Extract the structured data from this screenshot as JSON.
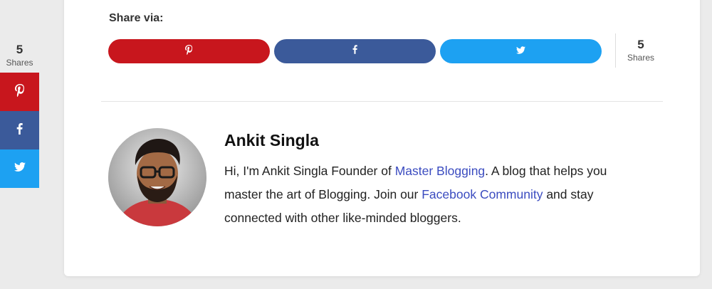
{
  "sidebar": {
    "count": "5",
    "count_label": "Shares",
    "buttons": [
      {
        "network": "pinterest",
        "icon": "pinterest-icon",
        "color": "#c8161d"
      },
      {
        "network": "facebook",
        "icon": "facebook-icon",
        "color": "#3b5a9a"
      },
      {
        "network": "twitter",
        "icon": "twitter-icon",
        "color": "#1da1f2"
      }
    ]
  },
  "share": {
    "label": "Share via:",
    "total": "5",
    "total_label": "Shares",
    "buttons": [
      {
        "network": "pinterest",
        "icon": "pinterest-icon",
        "color": "#c8161d"
      },
      {
        "network": "facebook",
        "icon": "facebook-icon",
        "color": "#3b5a9a"
      },
      {
        "network": "twitter",
        "icon": "twitter-icon",
        "color": "#1da1f2"
      }
    ]
  },
  "author": {
    "name": "Ankit Singla",
    "bio_part1": "Hi, I'm Ankit Singla Founder of ",
    "link1": "Master Blogging",
    "bio_part2": ". A blog that helps you master the art of Blogging. Join our ",
    "link2": "Facebook Community",
    "bio_part3": " and stay connected with other like-minded bloggers."
  }
}
